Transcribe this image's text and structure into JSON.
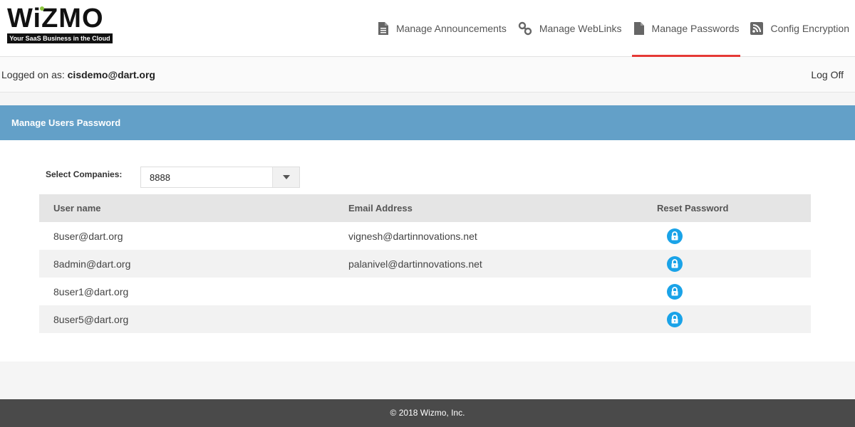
{
  "brand": {
    "name": "WiZMO",
    "tagline": "Your SaaS Business in the Cloud"
  },
  "nav": {
    "items": [
      {
        "label": "Manage Announcements",
        "icon": "document-icon",
        "active": false
      },
      {
        "label": "Manage WebLinks",
        "icon": "link-icon",
        "active": false
      },
      {
        "label": "Manage Passwords",
        "icon": "document-icon",
        "active": true
      },
      {
        "label": "Config Encryption",
        "icon": "rss-icon",
        "active": false
      }
    ],
    "active_color": "#e53935"
  },
  "session": {
    "prefix": "Logged on as:",
    "user": "cisdemo@dart.org",
    "logoff_label": "Log Off"
  },
  "panel": {
    "title": "Manage Users Password",
    "header_color": "#63a0c8",
    "company_label": "Select Companies:",
    "company_value": "8888",
    "table": {
      "headers": [
        "User name",
        "Email Address",
        "Reset Password"
      ],
      "rows": [
        {
          "user": "8user@dart.org",
          "email": "vignesh@dartinnovations.net"
        },
        {
          "user": "8admin@dart.org",
          "email": "palanivel@dartinnovations.net"
        },
        {
          "user": "8user1@dart.org",
          "email": ""
        },
        {
          "user": "8user5@dart.org",
          "email": ""
        }
      ],
      "action_icon": "lock-icon",
      "action_color": "#1aa3e8"
    }
  },
  "footer": {
    "text": "© 2018 Wizmo, Inc."
  }
}
